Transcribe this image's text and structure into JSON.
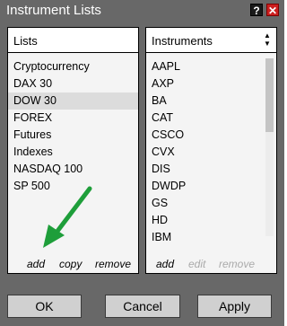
{
  "window": {
    "title": "Instrument Lists",
    "help_label": "?",
    "close_label": "✕"
  },
  "lists_panel": {
    "header": "Lists",
    "items": [
      "Cryptocurrency",
      "DAX 30",
      "DOW 30",
      "FOREX",
      "Futures",
      "Indexes",
      "NASDAQ 100",
      "SP 500"
    ],
    "selected": "DOW 30",
    "actions": {
      "add": "add",
      "copy": "copy",
      "remove": "remove"
    }
  },
  "instruments_panel": {
    "header": "Instruments",
    "sort_up": "▲",
    "sort_down": "▼",
    "items": [
      "AAPL",
      "AXP",
      "BA",
      "CAT",
      "CSCO",
      "CVX",
      "DIS",
      "DWDP",
      "GS",
      "HD",
      "IBM"
    ],
    "actions": {
      "add": "add",
      "edit": "edit",
      "remove": "remove"
    },
    "disabled_actions": [
      "edit",
      "remove"
    ]
  },
  "buttons": {
    "ok": "OK",
    "cancel": "Cancel",
    "apply": "Apply"
  },
  "colors": {
    "frame": "#686868",
    "panel_bg": "#f4f4f4",
    "selection": "#dcdcdc",
    "button_bg": "#d0d0d0",
    "annotation_arrow": "#1e9e3a",
    "close_button": "#cc1f1f"
  },
  "annotation": {
    "icon": "green-arrow-icon",
    "points_to": "add"
  }
}
